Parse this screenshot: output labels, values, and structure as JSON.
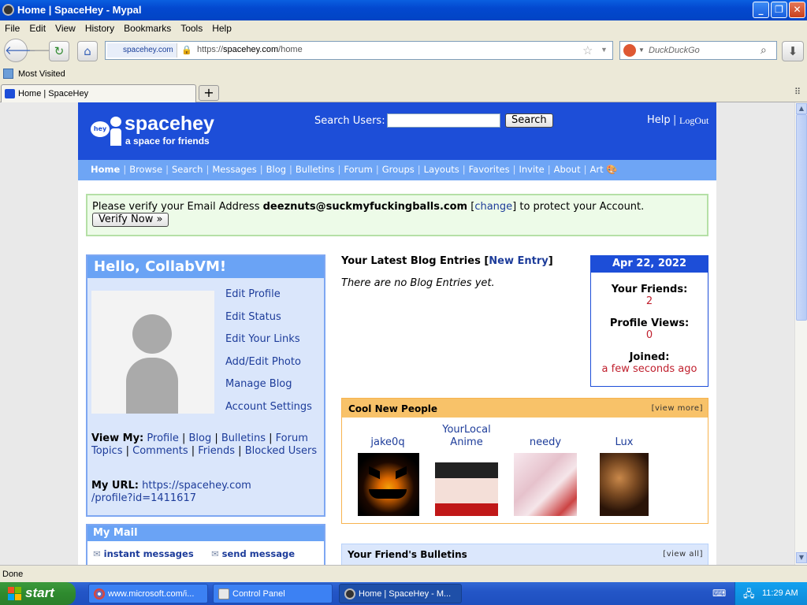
{
  "window": {
    "title": "Home | SpaceHey - Mypal"
  },
  "menu": [
    "File",
    "Edit",
    "View",
    "History",
    "Bookmarks",
    "Tools",
    "Help"
  ],
  "toolbar": {
    "site_badge": "spacehey.com",
    "url_prefix": "https://",
    "url_host": "spacehey.com",
    "url_path": "/home",
    "search_placeholder": "DuckDuckGo"
  },
  "bookmarks": {
    "most_visited": "Most Visited"
  },
  "tabs": [
    {
      "label": "Home | SpaceHey"
    }
  ],
  "page": {
    "logo_badge": "hey",
    "logo_name": "spacehey",
    "logo_tagline": "a space for friends",
    "search_label": "Search Users:",
    "search_button": "Search",
    "help": "Help",
    "logout": "LogOut",
    "nav": [
      "Home",
      "Browse",
      "Search",
      "Messages",
      "Blog",
      "Bulletins",
      "Forum",
      "Groups",
      "Layouts",
      "Favorites",
      "Invite",
      "About",
      "Art"
    ],
    "verify": {
      "text_before": "Please verify your Email Address",
      "email": "deeznuts@suckmyfuckingballs.com",
      "change": "change",
      "text_after": "to protect your Account.",
      "button": "Verify Now »"
    },
    "profile": {
      "hello": "Hello, CollabVM!",
      "links": [
        "Edit Profile",
        "Edit Status",
        "Edit Your Links",
        "Add/Edit Photo",
        "Manage Blog",
        "Account Settings"
      ],
      "view_my_label": "View My:",
      "view_my_links": [
        "Profile",
        "Blog",
        "Bulletins",
        "Forum Topics",
        "Comments",
        "Friends",
        "Blocked Users"
      ],
      "my_url_label": "My URL:",
      "my_url_line1": "https://spacehey.com",
      "my_url_line2": "/profile?id=1411617"
    },
    "mail": {
      "title": "My Mail",
      "instant": "instant messages",
      "send": "send message"
    },
    "blog": {
      "title": "Your Latest Blog Entries",
      "new_entry": "New Entry",
      "empty": "There are no Blog Entries yet."
    },
    "stats": {
      "date": "Apr 22, 2022",
      "friends_label": "Your Friends:",
      "friends_value": "2",
      "views_label": "Profile Views:",
      "views_value": "0",
      "joined_label": "Joined:",
      "joined_value": "a few seconds ago"
    },
    "cool": {
      "title": "Cool New People",
      "view_more": "[view more]",
      "people": [
        "jake0q",
        "YourLocal Anime",
        "needy",
        "Lux"
      ]
    },
    "bulletins": {
      "title": "Your Friend's Bulletins",
      "view_all": "[view all]"
    }
  },
  "status": {
    "text": "Done"
  },
  "taskbar": {
    "start": "start",
    "items": [
      "www.microsoft.com/i...",
      "Control Panel",
      "Home | SpaceHey - M..."
    ],
    "clock": "11:29 AM"
  }
}
